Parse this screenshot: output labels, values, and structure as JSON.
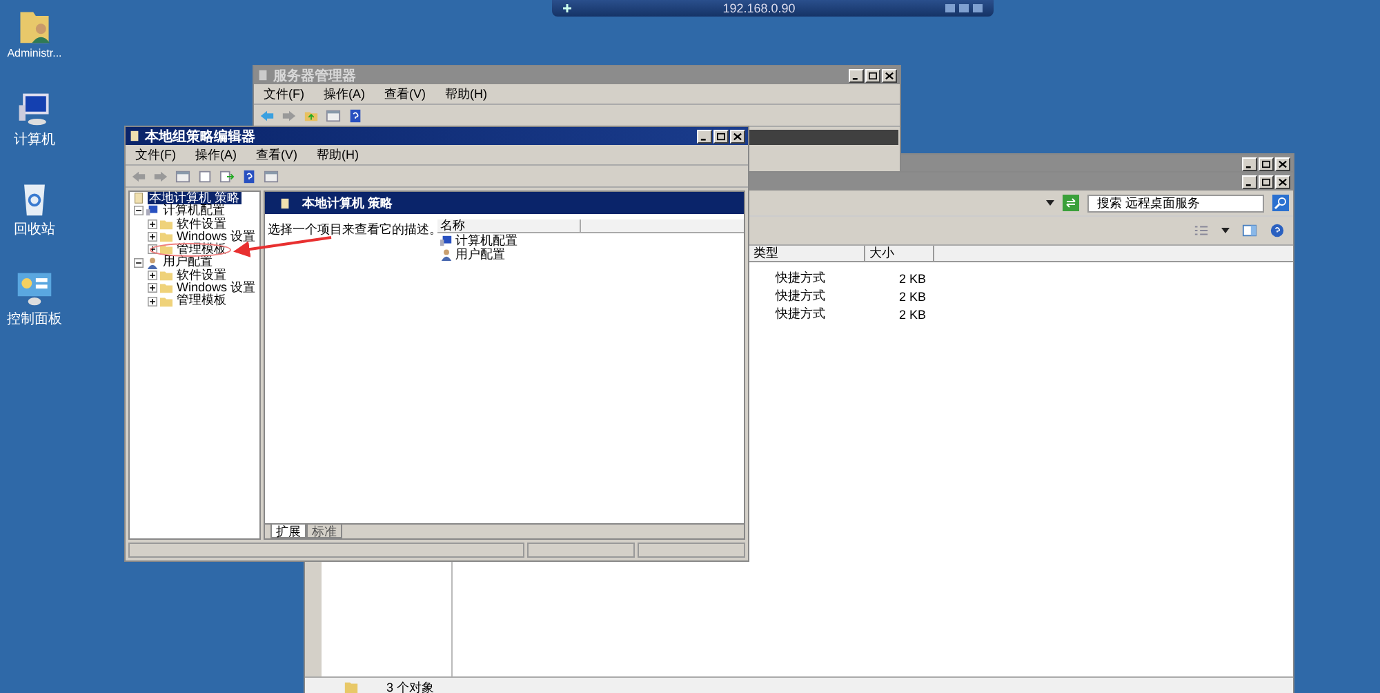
{
  "remote_bar": {
    "title": "192.168.0.90"
  },
  "desktop_icons": [
    {
      "kind": "user-folder",
      "label": "Administr..."
    },
    {
      "kind": "computer",
      "label": "计算机"
    },
    {
      "kind": "recycle-bin",
      "label": "回收站"
    },
    {
      "kind": "control-panel",
      "label": "控制面板"
    }
  ],
  "back_window": {
    "active": false
  },
  "server_manager": {
    "title": "服务器管理器",
    "active": false,
    "menu": [
      "文件(F)",
      "操作(A)",
      "查看(V)",
      "帮助(H)"
    ]
  },
  "explorer": {
    "active": false,
    "search": {
      "placeholder": "搜索 远程桌面服务"
    },
    "columns": [
      "类型",
      "大小"
    ],
    "rows": [
      {
        "type": "快捷方式",
        "size": "2 KB"
      },
      {
        "type": "快捷方式",
        "size": "2 KB"
      },
      {
        "type": "快捷方式",
        "size": "2 KB"
      }
    ],
    "status": "3 个对象"
  },
  "gpedit": {
    "title": "本地组策略编辑器",
    "active": true,
    "menu": [
      "文件(F)",
      "操作(A)",
      "查看(V)",
      "帮助(H)"
    ],
    "tree": [
      {
        "kind": "policy",
        "label": "本地计算机 策略",
        "selected": true,
        "expanded": true,
        "children": [
          {
            "kind": "computer",
            "label": "计算机配置",
            "selected": false,
            "expanded": true,
            "children": [
              {
                "kind": "folder",
                "label": "软件设置",
                "selected": false,
                "expanded": false
              },
              {
                "kind": "folder",
                "label": "Windows 设置",
                "selected": false,
                "expanded": false
              },
              {
                "kind": "folder",
                "label": "管理模板",
                "selected": false,
                "expanded": false
              }
            ]
          },
          {
            "kind": "user",
            "label": "用户配置",
            "selected": false,
            "expanded": true,
            "children": [
              {
                "kind": "folder",
                "label": "软件设置",
                "selected": false,
                "expanded": false
              },
              {
                "kind": "folder",
                "label": "Windows 设置",
                "selected": false,
                "expanded": false
              },
              {
                "kind": "folder",
                "label": "管理模板",
                "selected": false,
                "expanded": false
              }
            ]
          }
        ]
      }
    ],
    "header": "本地计算机 策略",
    "description": "选择一个项目来查看它的描述。",
    "list_column": "名称",
    "list_items": [
      {
        "kind": "computer",
        "label": "计算机配置"
      },
      {
        "kind": "user",
        "label": "用户配置"
      }
    ],
    "tabs": [
      {
        "label": "扩展",
        "selected": true
      },
      {
        "label": "标准",
        "selected": false
      }
    ]
  }
}
